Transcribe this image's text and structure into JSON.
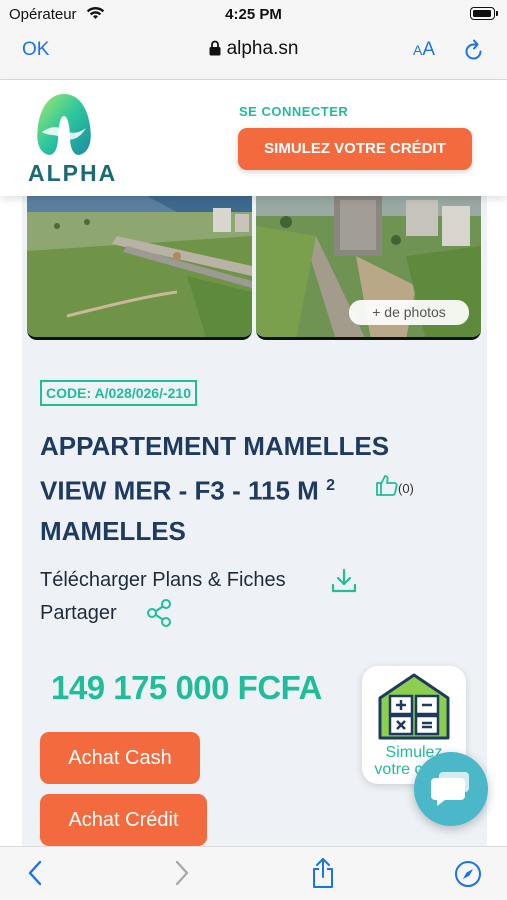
{
  "status": {
    "carrier": "Opérateur",
    "time": "4:25 PM"
  },
  "browser": {
    "done_label": "OK",
    "url": "alpha.sn",
    "text_size_label_big": "A",
    "text_size_label_small": "A"
  },
  "site": {
    "logo_text": "ALPHA",
    "login_label": "SE CONNECTER",
    "simulate_label": "SIMULEZ VOTRE CRÉDIT"
  },
  "listing": {
    "more_photos_label": "+ de photos",
    "code": "CODE: A/028/026/-210",
    "title_line1": "APPARTEMENT MAMELLES",
    "title_line2": "VIEW MER - F3 - 115 M",
    "title_sup": "2",
    "title_line3": "MAMELLES",
    "likes": "(0)",
    "download_label": "Télécharger Plans & Fiches",
    "share_label": "Partager",
    "price": "149 175 000 FCFA",
    "cash_label": "Achat Cash",
    "credit_label": "Achat Crédit"
  },
  "widget": {
    "simulate_text_1": "Simulez",
    "simulate_text_2": "votre crédit"
  },
  "colors": {
    "accent": "#1fbd9a",
    "orange": "#f26a3d",
    "navy": "#1e3a5f",
    "ios_blue": "#1a73e8",
    "chat": "#4ab8c8"
  }
}
